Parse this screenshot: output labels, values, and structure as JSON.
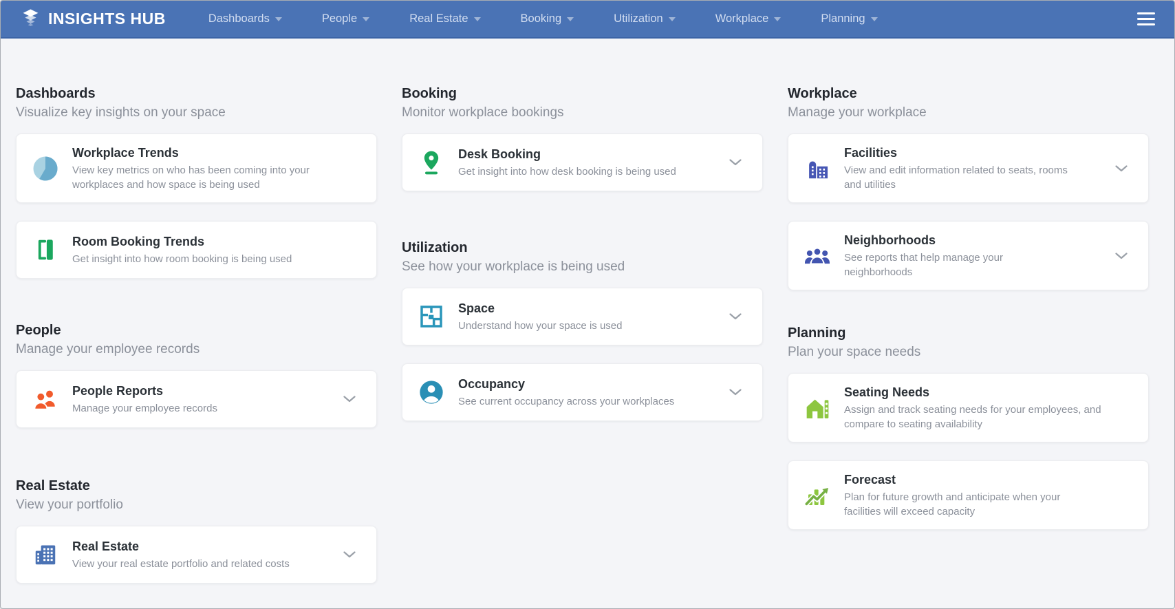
{
  "window": {
    "background": "#f4f5f8"
  },
  "nav": {
    "brand": "INSIGHTS HUB",
    "brand_icon": "insights-hub-logo-icon",
    "background": "#4a73b5",
    "hamburger_icon": "hamburger-menu-icon",
    "items": [
      {
        "label": "Dashboards"
      },
      {
        "label": "People"
      },
      {
        "label": "Real Estate"
      },
      {
        "label": "Booking"
      },
      {
        "label": "Utilization"
      },
      {
        "label": "Workplace"
      },
      {
        "label": "Planning"
      }
    ]
  },
  "columns": [
    {
      "sections": [
        {
          "title": "Dashboards",
          "subtitle": "Visualize key insights on your space",
          "cards": [
            {
              "title": "Workplace Trends",
              "description": "View key metrics on who has been coming into your workplaces and how space is being used",
              "icon": "pie-chart-icon",
              "icon_color": "#69abcc",
              "has_chevron": false
            },
            {
              "title": "Room Booking Trends",
              "description": "Get insight into how room booking is being used",
              "icon": "open-door-icon",
              "icon_color": "#1ba75e",
              "has_chevron": false
            }
          ]
        },
        {
          "title": "People",
          "subtitle": "Manage your employee records",
          "cards": [
            {
              "title": "People Reports",
              "description": "Manage your employee records",
              "icon": "people-icon",
              "icon_color": "#f15b2c",
              "has_chevron": true
            }
          ]
        },
        {
          "title": "Real Estate",
          "subtitle": "View your portfolio",
          "cards": [
            {
              "title": "Real Estate",
              "description": "View your real estate portfolio and related costs",
              "icon": "building-windows-icon",
              "icon_color": "#4a72b4",
              "has_chevron": true
            }
          ]
        }
      ]
    },
    {
      "sections": [
        {
          "title": "Booking",
          "subtitle": "Monitor workplace bookings",
          "cards": [
            {
              "title": "Desk Booking",
              "description": "Get insight into how desk booking is being used",
              "icon": "map-pin-icon",
              "icon_color": "#1ba75e",
              "has_chevron": true
            }
          ]
        },
        {
          "title": "Utilization",
          "subtitle": "See how your workplace is being used",
          "cards": [
            {
              "title": "Space",
              "description": "Understand how your space is used",
              "icon": "floorplan-icon",
              "icon_color": "#2a96ba",
              "has_chevron": true
            },
            {
              "title": "Occupancy",
              "description": "See current occupancy across your workplaces",
              "icon": "person-circle-icon",
              "icon_color": "#2a8fb5",
              "has_chevron": true
            }
          ]
        }
      ]
    },
    {
      "sections": [
        {
          "title": "Workplace",
          "subtitle": "Manage your workplace",
          "cards": [
            {
              "title": "Facilities",
              "description": "View and edit information related to seats, rooms and utilities",
              "icon": "building-tower-icon",
              "icon_color": "#4656b4",
              "has_chevron": true
            },
            {
              "title": "Neighborhoods",
              "description": "See reports that help manage your neighborhoods",
              "icon": "people-group-icon",
              "icon_color": "#4355b0",
              "has_chevron": true
            }
          ]
        },
        {
          "title": "Planning",
          "subtitle": "Plan your space needs",
          "cards": [
            {
              "title": "Seating Needs",
              "description": "Assign and track seating needs for your employees, and compare to seating availability",
              "icon": "house-icon",
              "icon_color": "#8dc63f",
              "has_chevron": false
            },
            {
              "title": "Forecast",
              "description": "Plan for future growth and anticipate when your facilities will exceed capacity",
              "icon": "growth-chart-icon",
              "icon_color": "#8dc63f",
              "has_chevron": false
            }
          ]
        }
      ]
    }
  ]
}
